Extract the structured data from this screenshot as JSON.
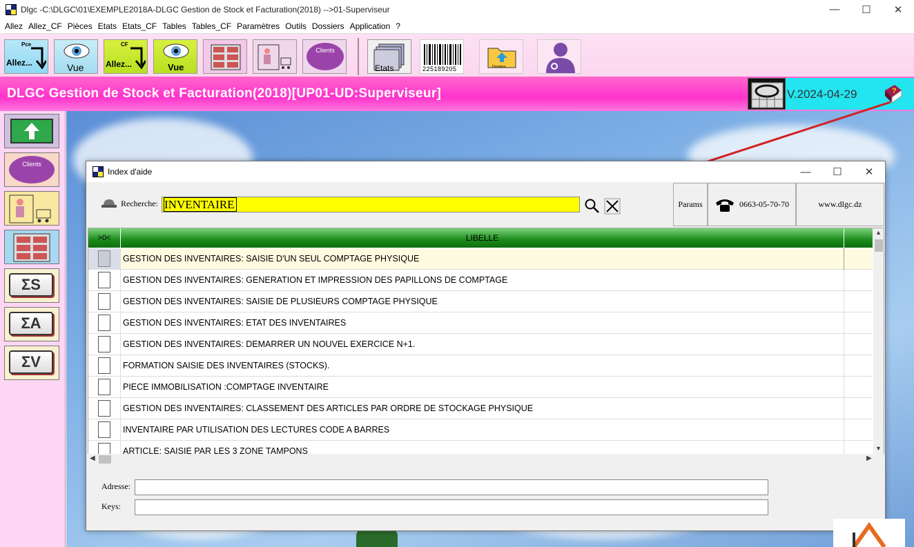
{
  "window": {
    "title": "Dlgc -C:\\DLGC\\01\\EXEMPLE2018A-DLGC Gestion de Stock et Facturation(2018) -->01-Superviseur",
    "controls": [
      "—",
      "☐",
      "✕"
    ]
  },
  "menu": [
    "Allez",
    "Allez_CF",
    "Pièces",
    "Etats",
    "Etats_CF",
    "Tables",
    "Tables_CF",
    "Paramètres",
    "Outils",
    "Dossiers",
    "Application",
    "?"
  ],
  "toolbar": {
    "allez_pce": {
      "small": "Pce",
      "label": "Allez..."
    },
    "vue1": {
      "label": "Vue"
    },
    "allez_cf": {
      "small": "CF",
      "label": "Allez..."
    },
    "vue2": {
      "label": "Vue"
    },
    "clients": {
      "label": "Clients"
    },
    "etats": {
      "label": "Etats"
    },
    "barcode": {
      "label": "225189205"
    },
    "dossiers": {
      "label": "Dossiers"
    }
  },
  "banner": {
    "title": "DLGC Gestion de Stock et Facturation(2018)[UP01-UD:Superviseur]",
    "version": "V.2024-04-29"
  },
  "sidebar": {
    "clients_label": "Clients",
    "sigma_s": "ΣS",
    "sigma_a": "ΣA",
    "sigma_v": "ΣV"
  },
  "dialog": {
    "title": "Index d'aide",
    "search_label": "Recherche:",
    "search_value": "INVENTAIRE",
    "params_label": "Params",
    "phone": "0663-05-70-70",
    "website": "www.dlgc.dz",
    "columns": [
      ">0<",
      "LIBELLE"
    ],
    "rows": [
      "GESTION DES INVENTAIRES: SAISIE D'UN SEUL COMPTAGE PHYSIQUE",
      "GESTION DES INVENTAIRES: GENERATION ET IMPRESSION DES PAPILLONS DE COMPTAGE",
      "GESTION DES INVENTAIRES: SAISIE DE PLUSIEURS COMPTAGE PHYSIQUE",
      "GESTION DES INVENTAIRES: ETAT DES INVENTAIRES",
      "GESTION DES INVENTAIRES: DEMARRER UN NOUVEL EXERCICE N+1.",
      "FORMATION SAISIE DES INVENTAIRES (STOCKS).",
      "PIECE IMMOBILISATION :COMPTAGE INVENTAIRE",
      "GESTION DES INVENTAIRES: CLASSEMENT DES ARTICLES PAR ORDRE DE STOCKAGE PHYSIQUE",
      "INVENTAIRE PAR UTILISATION DES LECTURES CODE A BARRES",
      "ARTICLE: SAISIE PAR LES 3 ZONE TAMPONS"
    ],
    "adresse_label": "Adresse:",
    "keys_label": "Keys:"
  },
  "colors": {
    "banner": "#ff33cc",
    "version_bg": "#22e5f0",
    "search_bg": "#ffff00",
    "grid_header": "#1a8a1a",
    "sidebar_bg": "#fcd6f4"
  }
}
